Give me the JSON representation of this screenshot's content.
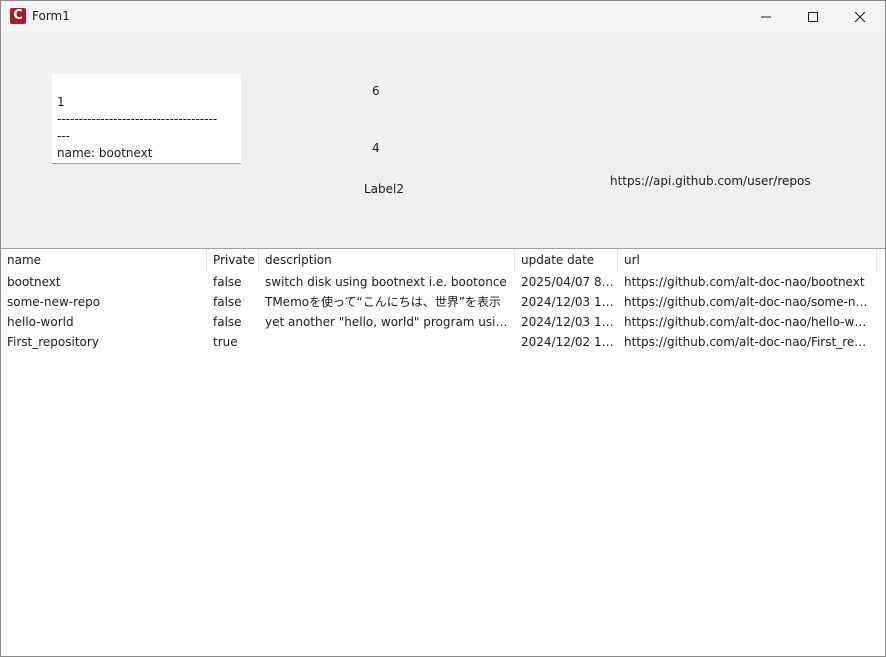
{
  "window": {
    "title": "Form1",
    "icon": "app-icon",
    "icon_letter": "C",
    "icon_color": "#a51d2d",
    "controls": [
      "minimize-icon",
      "maximize-icon",
      "close-icon"
    ]
  },
  "memo": {
    "lines": [
      "1",
      "-------------------------------------",
      "---",
      "name: bootnext"
    ]
  },
  "labels": {
    "label_6": "6",
    "label_4": "4",
    "label2": "Label2",
    "api_url": "https://api.github.com/user/repos"
  },
  "listview": {
    "columns": [
      "name",
      "Private",
      "description",
      "update date",
      "url"
    ],
    "rows": [
      [
        "bootnext",
        "false",
        "switch disk using bootnext i.e. bootonce",
        "2025/04/07 8:5...",
        "https://github.com/alt-doc-nao/bootnext"
      ],
      [
        "some-new-repo",
        "false",
        "TMemoを使って“こんにちは、世界”を表示",
        "2024/12/03 16:...",
        "https://github.com/alt-doc-nao/some-new-..."
      ],
      [
        "hello-world",
        "false",
        "yet another \"hello, world\" program using t...",
        "2024/12/03 14:...",
        "https://github.com/alt-doc-nao/hello-world"
      ],
      [
        "First_repository",
        "true",
        "",
        "2024/12/02 16:...",
        "https://github.com/alt-doc-nao/First_reposi..."
      ]
    ]
  }
}
